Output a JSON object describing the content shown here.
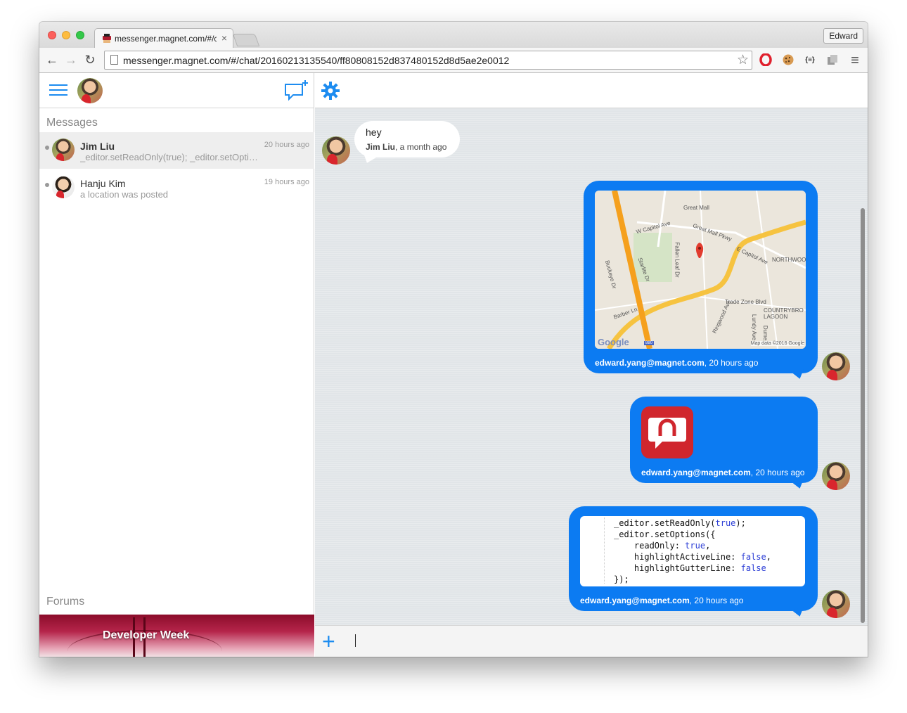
{
  "browser": {
    "tab_title": "messenger.magnet.com/#/c",
    "tab_close": "×",
    "profile_name": "Edward",
    "url": "messenger.magnet.com/#/chat/20160213135540/ff80808152d837480152d8d5ae2e0012",
    "back_icon": "←",
    "forward_icon": "→",
    "reload_icon": "↻",
    "star_icon": "☆",
    "ext_json": "{≡}",
    "menu_icon": "≡"
  },
  "sidebar": {
    "messages_label": "Messages",
    "forums_label": "Forums",
    "conversations": [
      {
        "name": "Jim Liu",
        "preview": "_editor.setReadOnly(true); _editor.setOptions({",
        "time": "20 hours ago",
        "active": true
      },
      {
        "name": "Hanju Kim",
        "preview": "a location was posted",
        "time": "19 hours ago",
        "active": false
      }
    ],
    "forum_banner_title": "Developer Week"
  },
  "chat": {
    "incoming": {
      "text": "hey",
      "sender": "Jim Liu",
      "time": ", a month ago"
    },
    "outgoing": [
      {
        "sender": "edward.yang@magnet.com",
        "time": ", 20 hours ago",
        "kind": "map"
      },
      {
        "sender": "edward.yang@magnet.com",
        "time": ", 20 hours ago",
        "kind": "image"
      },
      {
        "sender": "edward.yang@magnet.com",
        "time": ", 20 hours ago",
        "kind": "code"
      }
    ],
    "map_labels": {
      "great_mall": "Great Mall",
      "capitol_w": "W Capitol Ave",
      "great_mall_pkwy": "Great Mall Pkwy",
      "capitol_e": "E Capitol Ave",
      "northwood": "NORTHWOO",
      "trade_zone": "Trade Zone Blvd",
      "countrybrook": "COUNTRYBRO LAGOON",
      "ringwood": "Ringwood Ave",
      "buckeye": "Buckeye Dr",
      "barber": "Barber Ln",
      "starlite": "Starlite Dr",
      "fallen_leaf": "Fallen Leaf Dr",
      "lundy": "Lundy Ave",
      "dume": "Dume",
      "google": "Google",
      "map_data": "Map data ©2016 Google",
      "shield": "880"
    },
    "code_lines": [
      {
        "plain": "_editor.setReadOnly(",
        "kw": "true",
        "tail": ");"
      },
      {
        "plain": "_editor.setOptions({",
        "kw": "",
        "tail": ""
      },
      {
        "plain": "    readOnly: ",
        "kw": "true",
        "tail": ","
      },
      {
        "plain": "    highlightActiveLine: ",
        "kw": "false",
        "tail": ","
      },
      {
        "plain": "    highlightGutterLine: ",
        "kw": "false",
        "tail": ""
      },
      {
        "plain": "});",
        "kw": "",
        "tail": ""
      }
    ],
    "plus_icon": "+"
  },
  "colors": {
    "accent": "#1d8cf0",
    "bubble_out": "#0c7bf2",
    "chat_bg": "#e1e5e8"
  }
}
